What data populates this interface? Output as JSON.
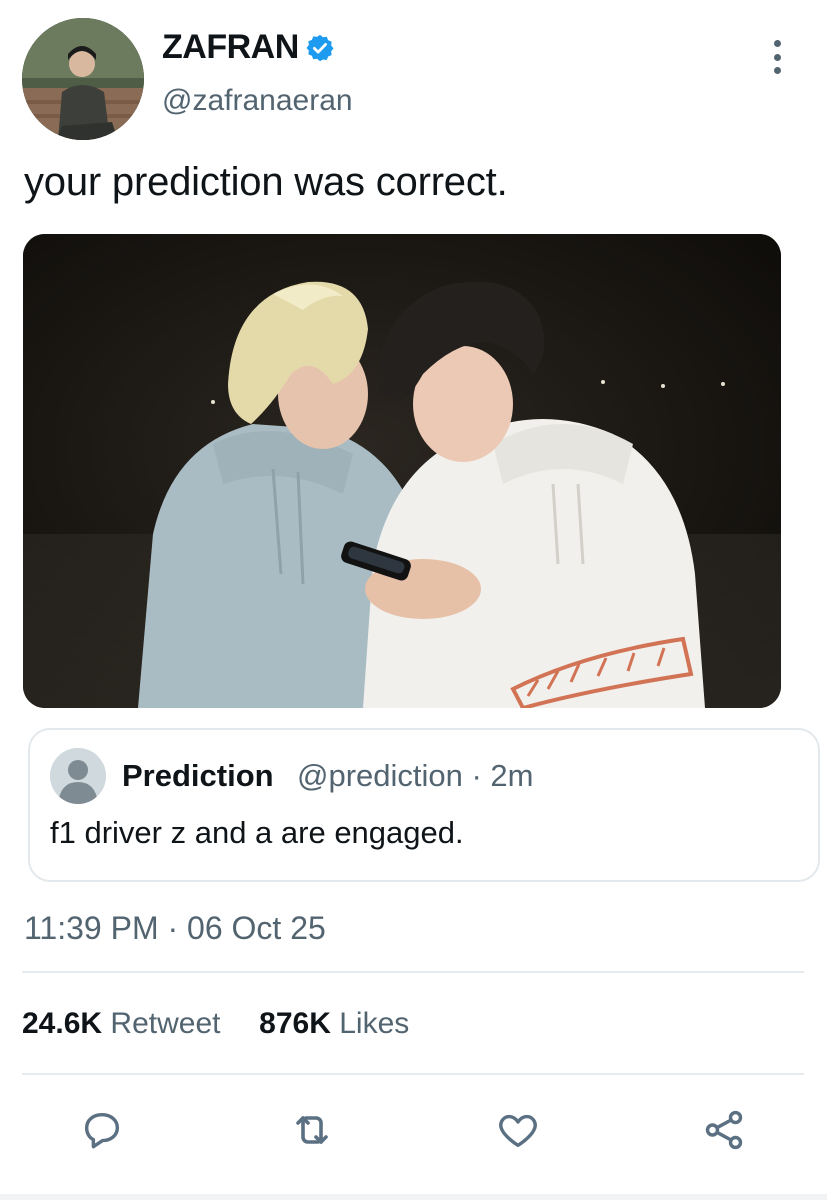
{
  "author": {
    "display_name": "ZAFRAN",
    "handle": "@zafranaeran",
    "verified": true
  },
  "tweet": {
    "text": "your prediction was correct."
  },
  "quoted_tweet": {
    "display_name": "Prediction",
    "meta": "@prediction · 2m",
    "text": "f1 driver z and a are engaged."
  },
  "timestamp": "11:39 PM · 06 Oct 25",
  "stats": {
    "retweets_count": "24.6K",
    "retweets_label": "Retweet",
    "likes_count": "876K",
    "likes_label": "Likes"
  },
  "icons": {
    "more": "more-vertical-icon",
    "verified": "verified-badge-icon",
    "reply": "reply-icon",
    "retweet": "retweet-icon",
    "like": "like-icon",
    "share": "share-icon"
  },
  "colors": {
    "accent": "#1d9bf0",
    "secondary_text": "#536471",
    "primary_text": "#0f1419",
    "icon": "#5b7083",
    "border": "#e3e8ec"
  }
}
